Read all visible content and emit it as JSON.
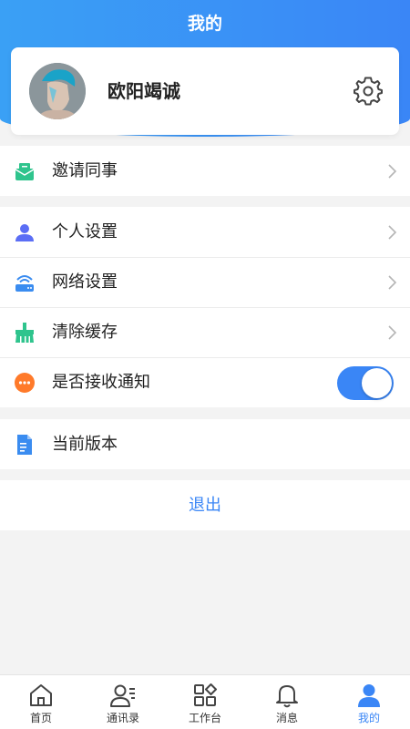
{
  "page": {
    "title": "我的"
  },
  "profile": {
    "name": "欧阳竭诚"
  },
  "menu": {
    "invite": "邀请同事",
    "personal_settings": "个人设置",
    "network_settings": "网络设置",
    "clear_cache": "清除缓存",
    "notifications": "是否接收通知",
    "notifications_enabled": true,
    "version": "当前版本"
  },
  "logout_label": "退出",
  "tabbar": {
    "items": [
      {
        "label": "首页",
        "icon": "home-icon"
      },
      {
        "label": "通讯录",
        "icon": "contacts-icon"
      },
      {
        "label": "工作台",
        "icon": "workbench-icon"
      },
      {
        "label": "消息",
        "icon": "bell-icon"
      },
      {
        "label": "我的",
        "icon": "user-icon"
      }
    ],
    "active": "我的"
  },
  "colors": {
    "accent": "#3a86f6",
    "header": "#3aa0f5",
    "invite": "#2fc48d",
    "user": "#5b6ef5",
    "network": "#3a8cf0",
    "cache": "#2fc48d",
    "notify": "#ff7a2a",
    "version": "#3a8cf0"
  }
}
